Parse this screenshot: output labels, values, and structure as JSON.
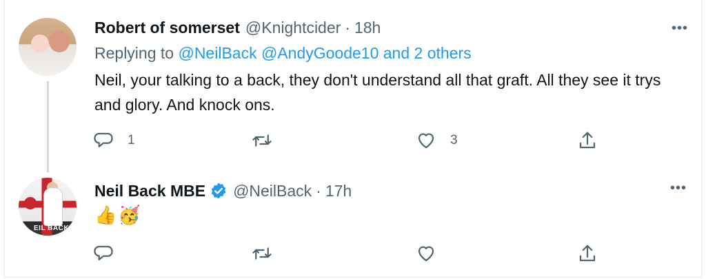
{
  "tweets": [
    {
      "author_name": "Robert of somerset",
      "handle": "@Knightcider",
      "separator": "·",
      "time": "18h",
      "replying_prefix": "Replying to",
      "replying_mentions": "@NeilBack @AndyGoode10 and 2 others",
      "text": "Neil, your talking to a back, they don't understand all that graft. All they see it trys and glory. And knock ons.",
      "reply_count": "1",
      "like_count": "3",
      "more_label": "•••"
    },
    {
      "author_name": "Neil Back MBE",
      "handle": "@NeilBack",
      "separator": "·",
      "time": "17h",
      "verified": true,
      "avatar_text": "EIL BACK",
      "emojis": [
        "👍",
        "🥳"
      ],
      "more_label": "•••"
    }
  ],
  "icons": {
    "reply": "reply-icon",
    "retweet": "retweet-icon",
    "like": "heart-icon",
    "share": "share-icon",
    "more": "more-icon",
    "verified": "verified-badge-icon"
  },
  "colors": {
    "text": "#0f1419",
    "secondary": "#536471",
    "link": "#1d9bf0",
    "thread_line": "#cfd9de"
  }
}
